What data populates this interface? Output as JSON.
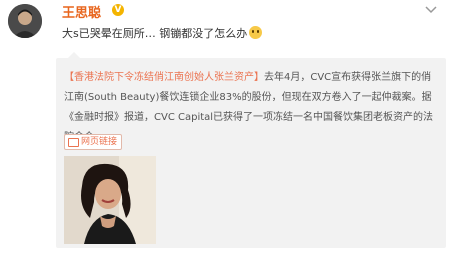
{
  "post": {
    "username": "王思聪",
    "verified_badge": "V",
    "content": "大s已哭晕在厕所… 钢镚都没了怎么办",
    "emoji_icon": "smile-emoji-icon"
  },
  "repost": {
    "tag": "【香港法院下令冻结俏江南创始人张兰资产】",
    "body": "去年4月，CVC宣布获得张兰旗下的俏江南(South Beauty)餐饮连锁企业83%的股份，但现在双方卷入了一起仲裁案。据《金融时报》报道，CVC Capital已获得了一项冻结一名中国餐饮集团老板资产的法院命令。",
    "link_label": "网页链接"
  },
  "colors": {
    "username": "#e8661e",
    "accent": "#eb7350",
    "repost_bg": "#f2f2f2"
  }
}
